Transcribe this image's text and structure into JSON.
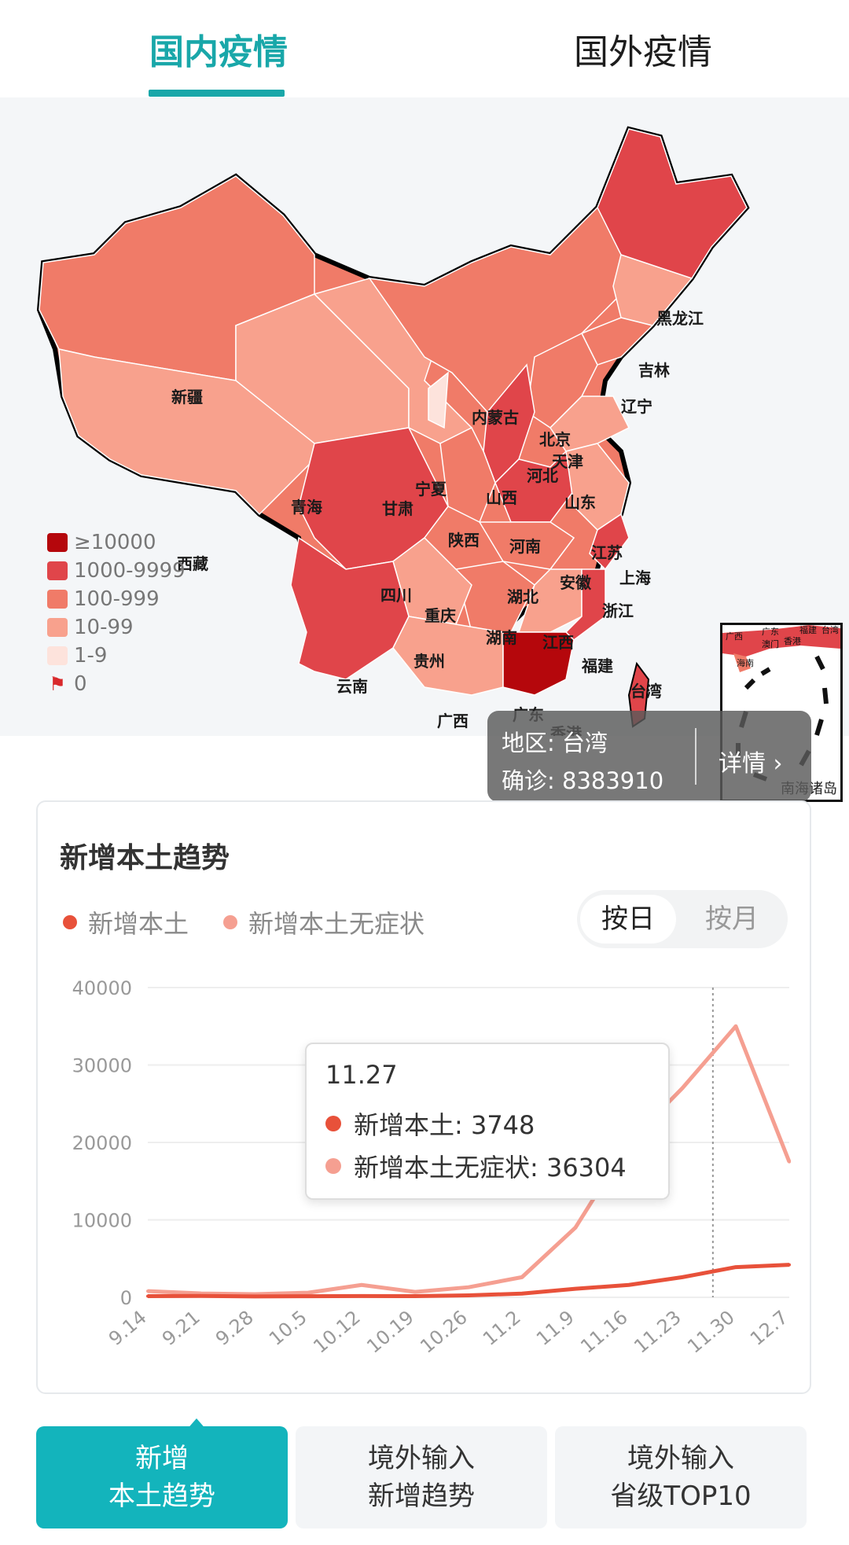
{
  "tabs": {
    "domestic": "国内疫情",
    "overseas": "国外疫情"
  },
  "colors": {
    "accent": "#19a7a9",
    "level_10000": "#b5070c",
    "level_1000": "#e0454a",
    "level_100": "#f07b68",
    "level_10": "#f8a18d",
    "level_1": "#fde3dc",
    "series_local": "#e8513a",
    "series_asym": "#f59f91"
  },
  "map": {
    "provinces": [
      "新疆",
      "西藏",
      "青海",
      "甘肃",
      "宁夏",
      "内蒙古",
      "黑龙江",
      "吉林",
      "辽宁",
      "北京",
      "天津",
      "河北",
      "山西",
      "山东",
      "陕西",
      "河南",
      "江苏",
      "上海",
      "安徽",
      "湖北",
      "四川",
      "重庆",
      "浙江",
      "湖南",
      "江西",
      "贵州",
      "福建",
      "云南",
      "广西",
      "广东",
      "香港",
      "台湾",
      "海南"
    ],
    "legend": [
      "≥10000",
      "1000-9999",
      "100-999",
      "10-99",
      "1-9",
      "0"
    ],
    "tooltip": {
      "region": "地区: 台湾",
      "confirmed": "确诊:  8383910",
      "detail": "详情 ›"
    },
    "inset_label": "南海诸岛",
    "inset_places": [
      "广西",
      "广东",
      "福建",
      "香港",
      "澳门",
      "海南",
      "台湾"
    ]
  },
  "chart": {
    "title": "新增本土趋势",
    "legend": [
      "新增本土",
      "新增本土无症状"
    ],
    "toggle": {
      "day": "按日",
      "month": "按月"
    },
    "tooltip": {
      "date": "11.27",
      "local": "新增本土: 3748",
      "asym": "新增本土无症状: 36304"
    }
  },
  "chart_data": {
    "type": "line",
    "x": [
      "9.14",
      "9.21",
      "9.28",
      "10.5",
      "10.12",
      "10.19",
      "10.26",
      "11.2",
      "11.9",
      "11.16",
      "11.23",
      "11.30",
      "12.7"
    ],
    "ylim": [
      0,
      40000
    ],
    "yticks": [
      "0",
      "10000",
      "20000",
      "30000",
      "40000"
    ],
    "series": [
      {
        "name": "新增本土",
        "values": [
          150,
          180,
          120,
          140,
          160,
          150,
          260,
          480,
          1100,
          1600,
          2600,
          3900,
          4200
        ]
      },
      {
        "name": "新增本土无症状",
        "values": [
          800,
          500,
          400,
          600,
          1600,
          700,
          1300,
          2600,
          9000,
          20000,
          27000,
          35000,
          17500
        ]
      }
    ]
  },
  "bottom_tabs": [
    {
      "line1": "新增",
      "line2": "本土趋势"
    },
    {
      "line1": "境外输入",
      "line2": "新增趋势"
    },
    {
      "line1": "境外输入",
      "line2": "省级TOP10"
    }
  ]
}
